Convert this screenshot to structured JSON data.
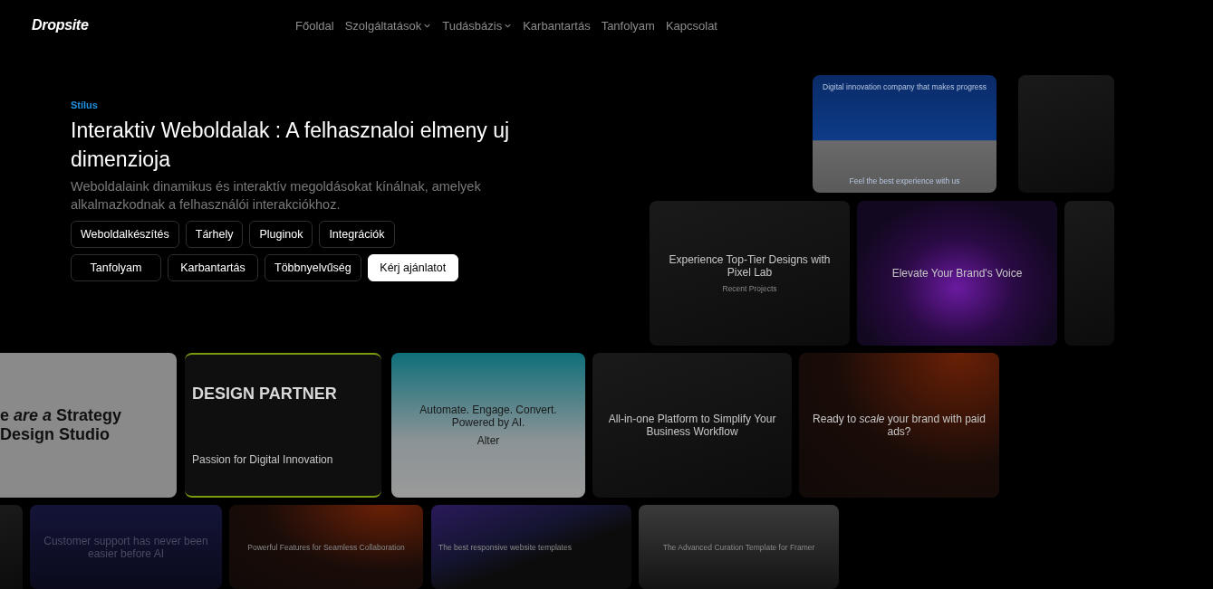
{
  "header": {
    "logo": "Dropsite",
    "nav": [
      {
        "label": "Főoldal",
        "has_menu": false
      },
      {
        "label": "Szolgáltatások",
        "has_menu": true
      },
      {
        "label": "Tudásbázis",
        "has_menu": true
      },
      {
        "label": "Karbantartás",
        "has_menu": false
      },
      {
        "label": "Tanfolyam",
        "has_menu": false
      },
      {
        "label": "Kapcsolat",
        "has_menu": false
      }
    ]
  },
  "hero": {
    "eyebrow": "Stílus",
    "title": "Interaktiv Weboldalak : A felhasznaloi elmeny uj dimenzioja",
    "description": "Weboldalaink dinamikus és interaktív megoldásokat kínálnak, amelyek alkalmazkodnak a felhasználói interakciókhoz.",
    "tag_rows": [
      [
        {
          "label": "Weboldalkészítés",
          "kind": "tag"
        },
        {
          "label": "Tárhely",
          "kind": "tag"
        },
        {
          "label": "Pluginok",
          "kind": "tag"
        },
        {
          "label": "Integrációk",
          "kind": "tag"
        }
      ],
      [
        {
          "label": "Tanfolyam",
          "kind": "tag"
        },
        {
          "label": "Karbantartás",
          "kind": "tag"
        },
        {
          "label": "Többnyelvűség",
          "kind": "tag"
        },
        {
          "label": "Kérj ajánlatot",
          "kind": "cta"
        }
      ]
    ]
  },
  "gallery": [
    {
      "kind": "blue",
      "texts": [
        {
          "text": "Digital innovation company that makes progress",
          "kind": "caption"
        },
        {
          "text": "Feel the best experience with us",
          "kind": "caption"
        }
      ]
    },
    {
      "kind": "dark"
    },
    {
      "kind": "dark",
      "texts": [
        {
          "text": "Experience Top-Tier Designs with Pixel Lab",
          "kind": "headline"
        },
        {
          "text": "Recent Projects",
          "kind": "caption"
        }
      ]
    },
    {
      "kind": "purple",
      "texts": [
        {
          "text": "Elevate Your Brand's Voice",
          "kind": "headline"
        }
      ]
    },
    {
      "kind": "dark"
    },
    {
      "kind": "light",
      "texts": [
        {
          "text": "e *are a* Strategy Design Studio",
          "kind": "display"
        }
      ]
    },
    {
      "kind": "lime",
      "texts": [
        {
          "text": "DESIGN PARTNER",
          "kind": "display"
        },
        {
          "text": "Passion for Digital Innovation",
          "kind": "headline"
        }
      ]
    },
    {
      "kind": "teal",
      "texts": [
        {
          "text": "Automate. Engage. Convert. Powered by AI.",
          "kind": "headline"
        },
        {
          "text": "Alter",
          "kind": "headline"
        }
      ]
    },
    {
      "kind": "dark",
      "texts": [
        {
          "text": "All-in-one Platform to Simplify Your Business Workflow",
          "kind": "headline"
        }
      ]
    },
    {
      "kind": "orange",
      "texts": [
        {
          "text": "Ready to *scale* your brand with paid ads?",
          "kind": "headline"
        }
      ]
    },
    {
      "kind": "dark"
    },
    {
      "kind": "navy",
      "texts": [
        {
          "text": "Customer support has never been easier before AI",
          "kind": "headline"
        }
      ]
    },
    {
      "kind": "orange",
      "texts": [
        {
          "text": "Powerful Features for Seamless Collaboration",
          "kind": "caption"
        }
      ]
    },
    {
      "kind": "violet",
      "texts": [
        {
          "text": "The best responsive website templates",
          "kind": "caption"
        }
      ]
    },
    {
      "kind": "grey",
      "texts": [
        {
          "text": "The Advanced Curation Template for Framer",
          "kind": "caption"
        }
      ]
    }
  ]
}
